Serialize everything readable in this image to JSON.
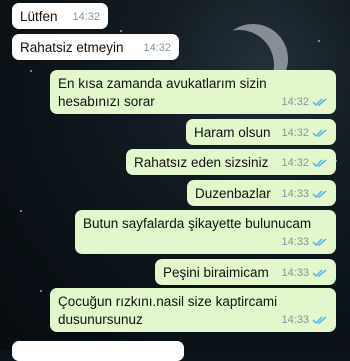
{
  "messages": [
    {
      "text": "Lütfen",
      "time": "14:32",
      "side": "in"
    },
    {
      "text": "Rahatsiz etmeyin",
      "time": "14:32",
      "side": "in"
    },
    {
      "text": "En kısa zamanda avukatlarım  sizin hesabınızı sorar",
      "time": "14:32",
      "side": "out",
      "read": true
    },
    {
      "text": "Haram olsun",
      "time": "14:32",
      "side": "out",
      "read": true
    },
    {
      "text": "Rahatsız eden sizsiniz",
      "time": "14:32",
      "side": "out",
      "read": true
    },
    {
      "text": "Duzenbazlar",
      "time": "14:33",
      "side": "out",
      "read": true
    },
    {
      "text": "Butun sayfalarda şikayette bulunucam",
      "time": "14:33",
      "side": "out",
      "read": true
    },
    {
      "text": "Peşini biraimicam",
      "time": "14:33",
      "side": "out",
      "read": true
    },
    {
      "text": "Çocuğun rızkını.nasil size kaptircami dusunursunuz",
      "time": "14:33",
      "side": "out",
      "read": true
    }
  ],
  "colors": {
    "outgoing_bubble": "#e2f7cb",
    "incoming_bubble": "#ffffff",
    "read_ticks": "#4fb6ec"
  }
}
